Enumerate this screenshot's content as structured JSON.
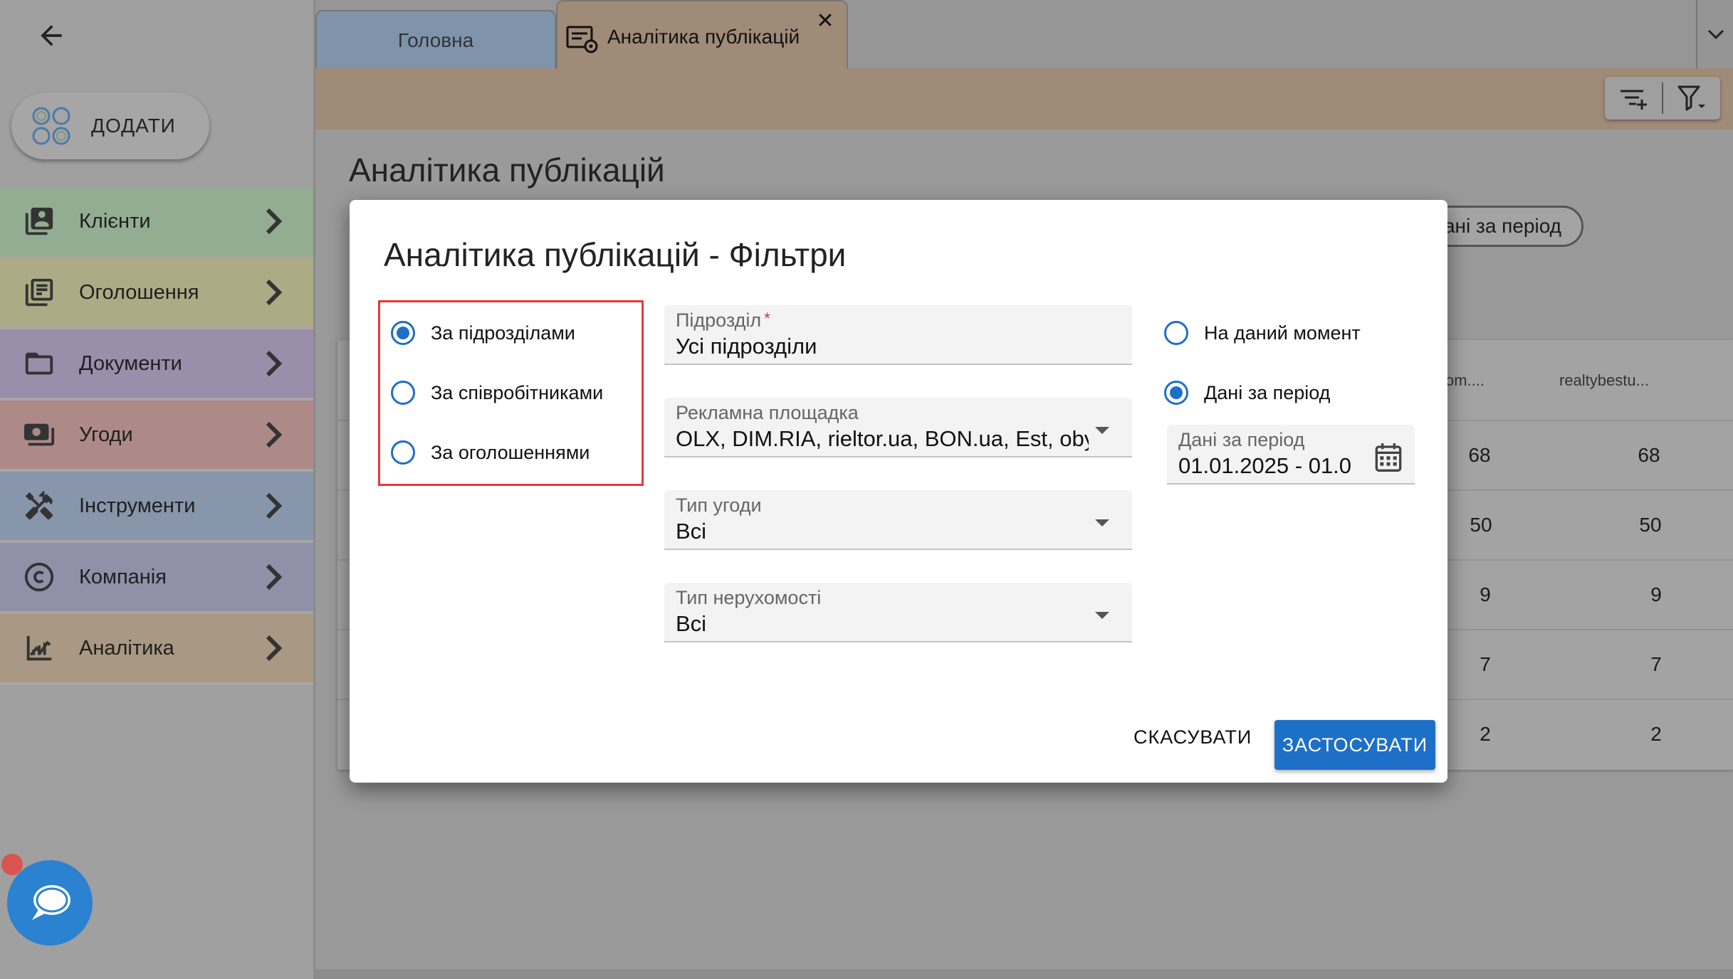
{
  "sidebar": {
    "add_label": "ДОДАТИ",
    "items": [
      {
        "label": "Клієнти",
        "icon": "contacts-icon",
        "color": "#93ad93"
      },
      {
        "label": "Оголошення",
        "icon": "listing-icon",
        "color": "#acab86"
      },
      {
        "label": "Документи",
        "icon": "folder-icon",
        "color": "#9b8eab"
      },
      {
        "label": "Угоди",
        "icon": "cash-icon",
        "color": "#ad8a88"
      },
      {
        "label": "Інструменти",
        "icon": "tools-icon",
        "color": "#8896ab"
      },
      {
        "label": "Компанія",
        "icon": "copyright-icon",
        "color": "#9090a8"
      },
      {
        "label": "Аналітика",
        "icon": "analytics-icon",
        "color": "#a89884"
      }
    ]
  },
  "tabs": {
    "home_label": "Головна",
    "active_label": "Аналітика публікацій",
    "close_glyph": "✕"
  },
  "page": {
    "title": "Аналітика публікацій",
    "period_button_label": "ані за період",
    "table": {
      "col_headers": [
        "om....",
        "realtybestu..."
      ],
      "rows": [
        [
          "68",
          "68"
        ],
        [
          "50",
          "50"
        ],
        [
          "9",
          "9"
        ],
        [
          "7",
          "7"
        ],
        [
          "2",
          "2"
        ]
      ]
    }
  },
  "modal": {
    "title": "Аналітика публікацій - Фільтри",
    "group_by": {
      "options": [
        "За підрозділами",
        "За співробітниками",
        "За оголошеннями"
      ],
      "selected": "За підрозділами"
    },
    "fields": {
      "division": {
        "label": "Підрозділ",
        "required_mark": "*",
        "value": "Усі підрозділи"
      },
      "platform": {
        "label": "Рекламна площадка",
        "value": "OLX, DIM.RIA, rieltor.ua, BON.ua, Est, obyavlenie"
      },
      "deal_type": {
        "label": "Тип угоди",
        "value": "Всі"
      },
      "property_type": {
        "label": "Тип нерухомості",
        "value": "Всі"
      }
    },
    "time_mode": {
      "options": [
        "На даний момент",
        "Дані за період"
      ],
      "selected": "Дані за період"
    },
    "period": {
      "label": "Дані за період",
      "value": "01.01.2025 - 01.0"
    },
    "cancel_label": "СКАСУВАТИ",
    "apply_label": "ЗАСТОСУВАТИ",
    "accent_color": "#1e6fc7"
  }
}
